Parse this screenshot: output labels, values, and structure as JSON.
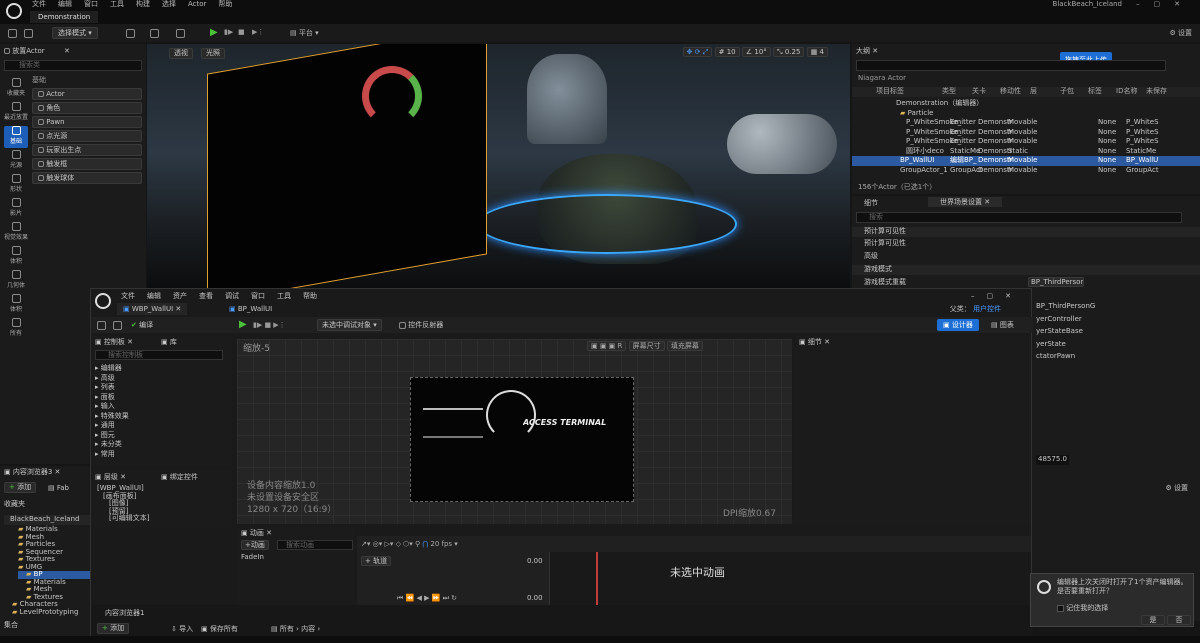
{
  "titlebar": {
    "menus": [
      "文件",
      "编辑",
      "窗口",
      "工具",
      "构建",
      "选择",
      "Actor",
      "帮助"
    ],
    "project": "BlackBeach_Iceland",
    "tab": "Demonstration"
  },
  "toolbar": {
    "select_mode": "选择模式",
    "platform": "平台",
    "settings": "设置"
  },
  "place_actors": {
    "title": "放置Actor",
    "search": "搜索类",
    "category": "基础",
    "items": [
      "Actor",
      "角色",
      "Pawn",
      "点光源",
      "玩家出生点",
      "触发框",
      "触发球体"
    ],
    "sidebar": [
      "收藏夹",
      "最近放置",
      "基础",
      "光源",
      "形状",
      "影片",
      "视觉效果",
      "体积",
      "几何体",
      "体积",
      "所有"
    ]
  },
  "viewport": {
    "perspective": "透视",
    "lit": "光照",
    "grid": "10",
    "angle": "10°",
    "scale": "0.25",
    "cam": "4"
  },
  "outliner": {
    "title": "大纲",
    "upload": "拖拽至此上传",
    "niagara": "Niagara Actor",
    "cols": [
      "项目标签",
      "类型",
      "关卡",
      "移动性",
      "层",
      "子包",
      "标签",
      "ID名称",
      "未保存"
    ],
    "rows": [
      [
        "Demonstration（编辑器）",
        "",
        "",
        "",
        "",
        ""
      ],
      [
        "Particle",
        "",
        "",
        "",
        "",
        ""
      ],
      [
        "P_WhiteSmoke_",
        "Emitter",
        "Demonstr",
        "Movable",
        "None",
        "P_WhiteS"
      ],
      [
        "P_WhiteSmoke_",
        "Emitter",
        "Demonstr",
        "Movable",
        "None",
        "P_WhiteS"
      ],
      [
        "P_WhiteSmoke_",
        "Emitter",
        "Demonstr",
        "Movable",
        "None",
        "P_WhiteS"
      ],
      [
        "圆环小deco",
        "StaticMe",
        "Demonstr",
        "Static",
        "None",
        "StaticMe"
      ],
      [
        "BP_WallUI",
        "编辑BP_",
        "Demonstr",
        "Movable",
        "None",
        "BP_WallU"
      ],
      [
        "GroupActor_1",
        "GroupAct",
        "Demonstr",
        "Movable",
        "None",
        "GroupAct"
      ]
    ],
    "count": "156个Actor（已选1个）"
  },
  "details": {
    "tab1": "细节",
    "tab2": "世界场景设置",
    "search": "搜索",
    "sections": [
      "预计算可见性",
      "预计算可见性",
      "高级",
      "游戏模式"
    ],
    "gamemode_label": "游戏模式重载",
    "gamemode_value": "BP_ThirdPersonG",
    "sub": [
      "BP_ThirdPersonG",
      "yerController",
      "yerStateBase",
      "yerState",
      "ctatorPawn"
    ],
    "value": "48575.0",
    "settings": "设置"
  },
  "umg": {
    "menus": [
      "文件",
      "编辑",
      "资产",
      "查看",
      "调试",
      "窗口",
      "工具",
      "帮助"
    ],
    "tab": "WBP_WallUI",
    "tab2": "BP_WallUI",
    "parent": "父类：",
    "parent_v": "用户控件",
    "compile": "编译",
    "debug": "未选中调试对象",
    "reflector": "控件反射器",
    "designer": "设计器",
    "graph": "图表",
    "palette": "控制板",
    "library": "库",
    "search": "搜索控制板",
    "cats": [
      "编辑器",
      "高级",
      "列表",
      "面板",
      "输入",
      "特殊效果",
      "通用",
      "图元",
      "未分类",
      "常用"
    ],
    "zoom": "缩放-5",
    "screen": "屏幕尺寸",
    "fill": "填充屏幕",
    "dpi": "DPI缩放0.67",
    "info1": "设备内容缩放1.0",
    "info2": "未设置设备安全区",
    "info3": "1280 x 720（16:9）",
    "hier": "层级",
    "bind": "绑定控件",
    "hier_items": [
      "[WBP_WallUI]",
      "[画布面板]",
      "[图像]",
      "[预留]",
      "[可编辑文本]"
    ],
    "details": "细节",
    "anim": "动画",
    "add_anim": "+动画",
    "anim_search": "搜索动画",
    "anim_item": "FadeIn",
    "track": "+ 轨道",
    "fps": "20 fps",
    "time1": "0.00",
    "time2": "0.00",
    "noanim": "未选中动画",
    "content": "内容浏览器1",
    "add": "添加",
    "import": "导入",
    "saveall": "保存所有",
    "path1": "所有",
    "path2": "内容",
    "access": "ACCESS TERMINAL"
  },
  "content_browser": {
    "title": "内容浏览器3",
    "add": "添加",
    "fab": "Fab",
    "favorites": "收藏夹",
    "root": "BlackBeach_Iceland",
    "folders": [
      "Materials",
      "Mesh",
      "Particles",
      "Sequencer",
      "Textures",
      "UMG",
      "BP",
      "Materials",
      "Mesh",
      "Textures",
      "Characters",
      "LevelPrototyping"
    ],
    "collections": "集合"
  },
  "notify": {
    "text": "编辑器上次关闭时打开了1个资产编辑器。是否要重新打开？",
    "remember": "记住我的选择",
    "yes": "是",
    "no": "否"
  },
  "statusbar": {
    "settings": "设置"
  }
}
